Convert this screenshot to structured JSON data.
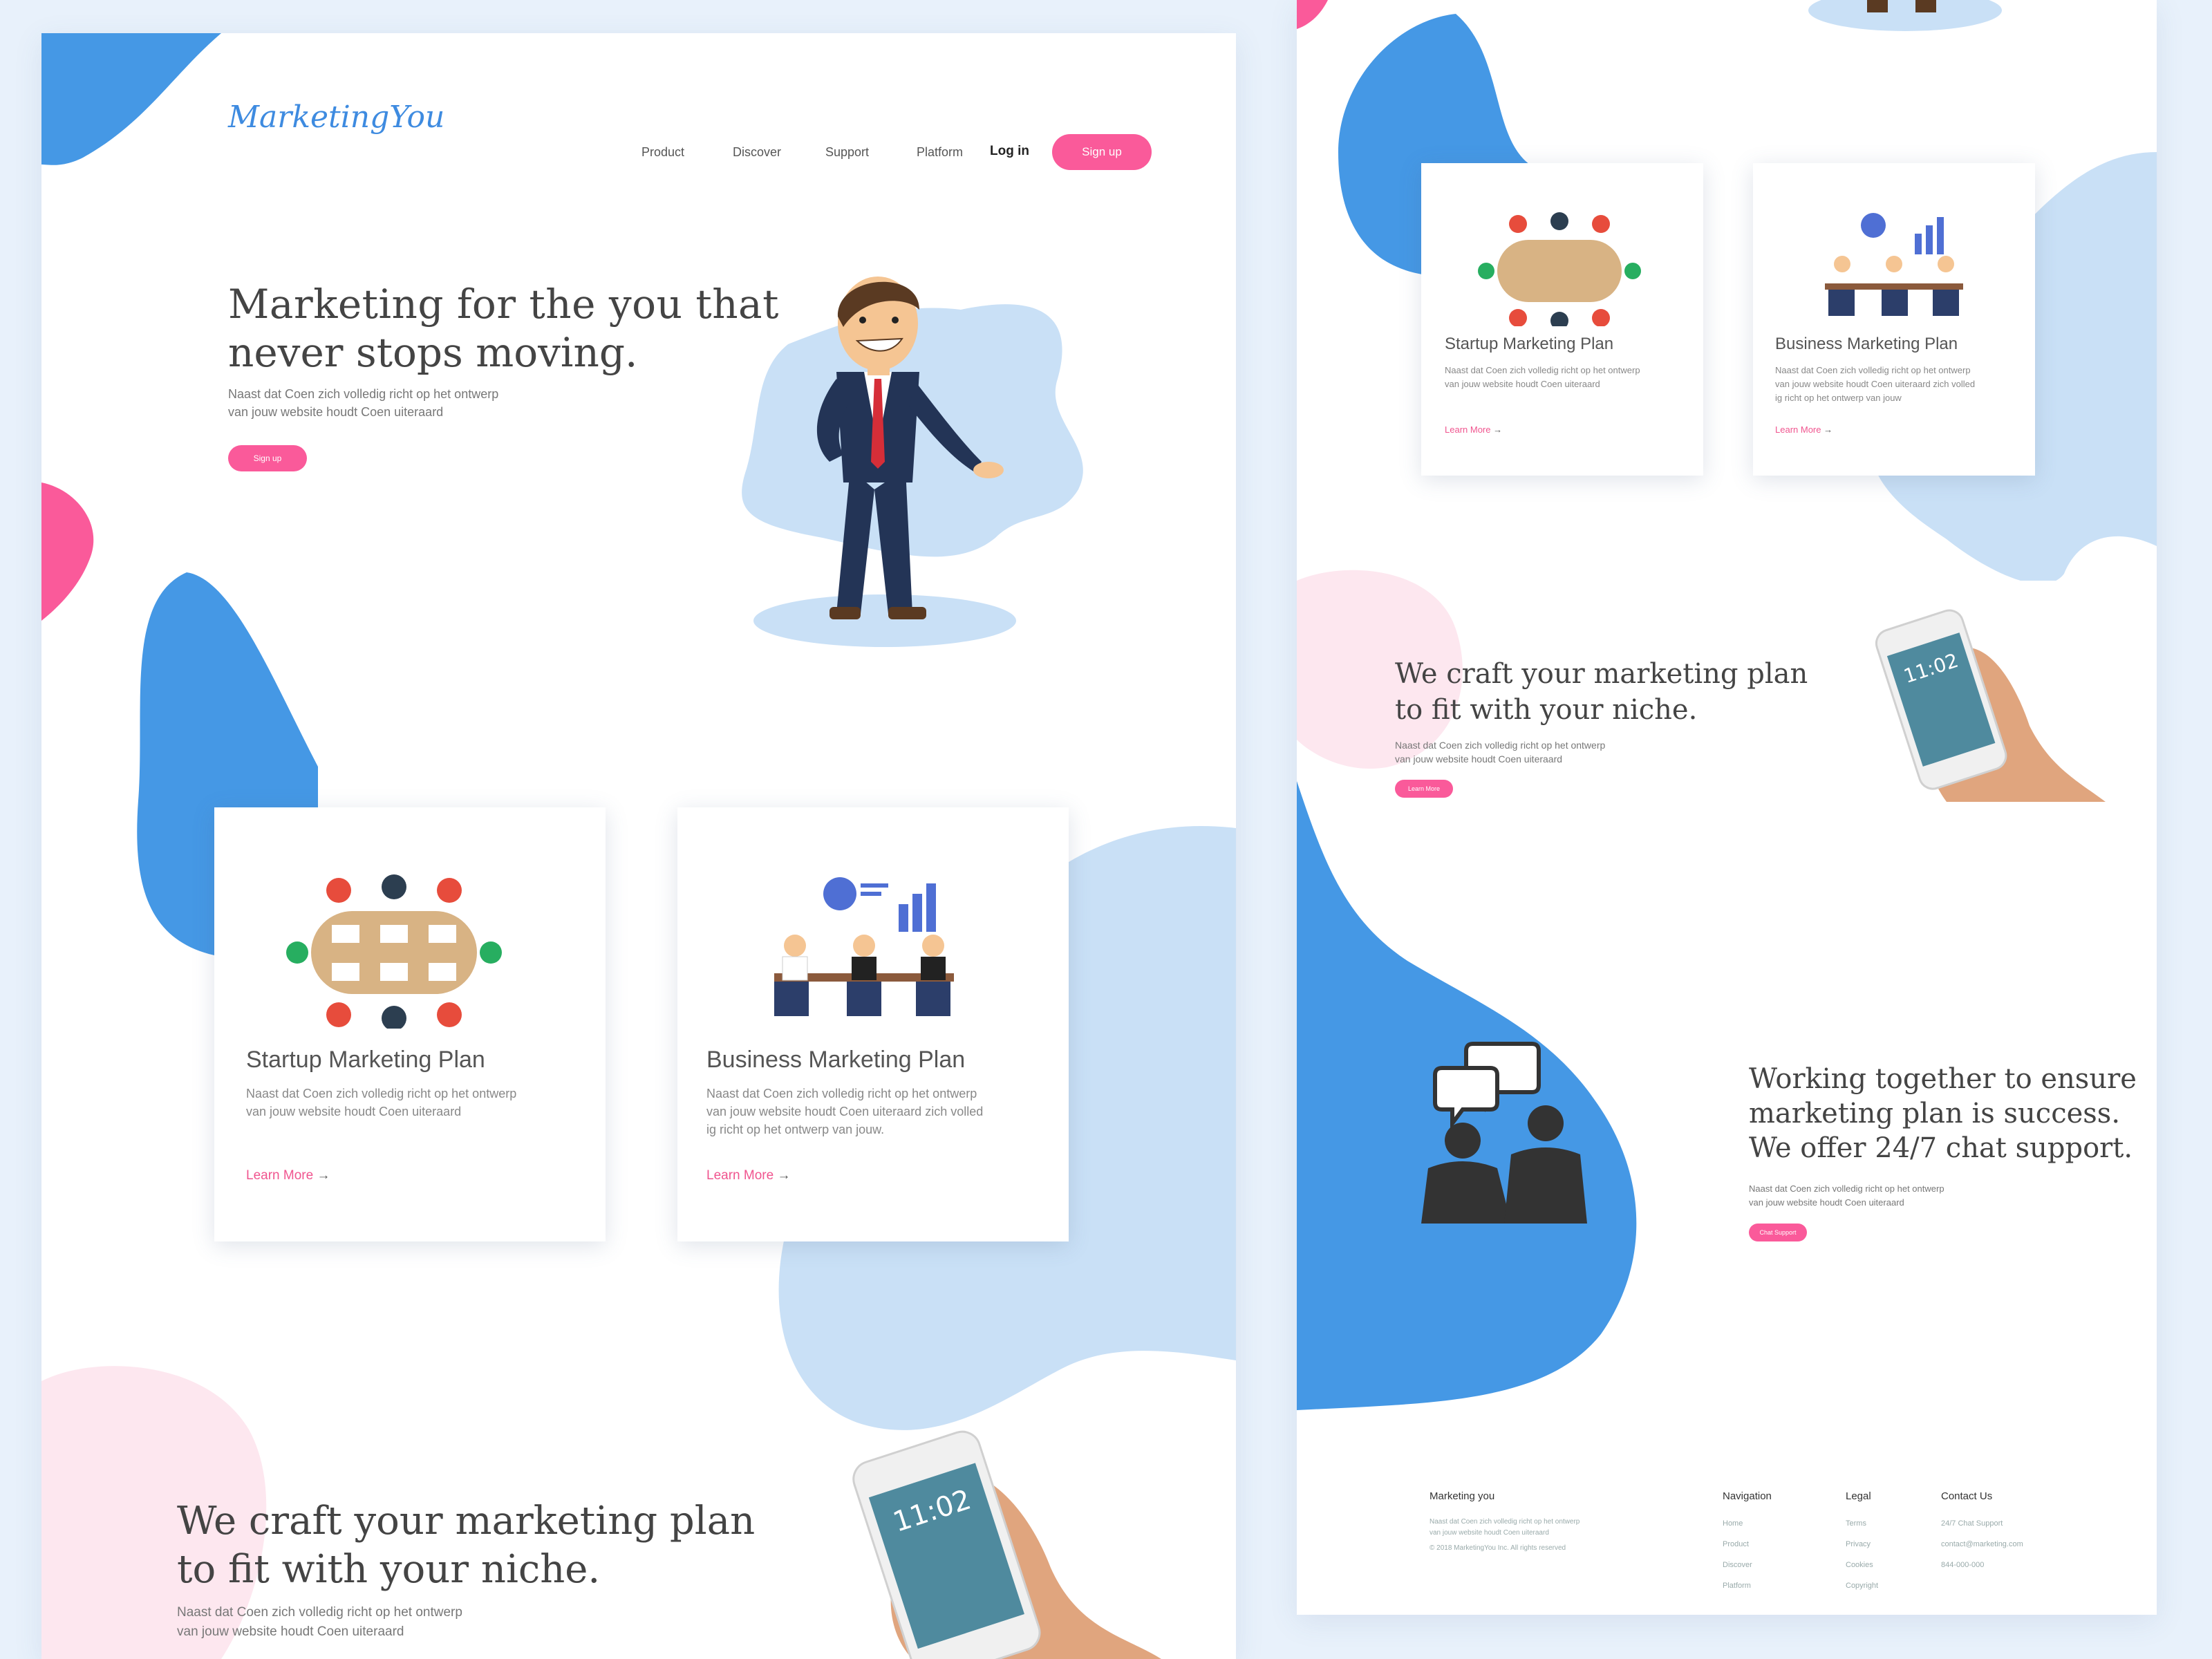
{
  "brand": {
    "logo": "MarketingYou"
  },
  "nav": {
    "links": [
      "Product",
      "Discover",
      "Support",
      "Platform"
    ],
    "login": "Log in",
    "signup": "Sign up"
  },
  "hero": {
    "title_line1": "Marketing for the you that",
    "title_line2": "never stops moving.",
    "desc_line1": "Naast dat Coen zich volledig richt op het ontwerp",
    "desc_line2": "van jouw website houdt Coen uiteraard",
    "cta": "Sign up"
  },
  "cards": [
    {
      "title": "Startup Marketing Plan",
      "desc_lines": [
        "Naast dat Coen zich volledig richt op het ontwerp",
        "van jouw website houdt Coen uiteraard"
      ],
      "link": "Learn More"
    },
    {
      "title": "Business Marketing Plan",
      "desc_lines": [
        "Naast dat Coen zich volledig richt op het ontwerp",
        "van jouw website houdt Coen uiteraard zich volled",
        "ig richt op het ontwerp van jouw."
      ],
      "link": "Learn More"
    }
  ],
  "right_cards": [
    {
      "title": "Startup Marketing Plan",
      "desc_lines": [
        "Naast dat Coen zich volledig richt op het ontwerp",
        "van jouw website houdt Coen uiteraard"
      ],
      "link": "Learn More"
    },
    {
      "title": "Business Marketing Plan",
      "desc_lines": [
        "Naast dat Coen zich volledig richt op het ontwerp",
        "van jouw website houdt Coen uiteraard zich volled",
        "ig richt op het ontwerp van jouw"
      ],
      "link": "Learn More"
    }
  ],
  "craft": {
    "title_line1": "We craft your marketing plan",
    "title_line2": "to fit with your niche.",
    "desc_line1": "Naast dat Coen zich volledig richt op het ontwerp",
    "desc_line2": "van jouw website houdt Coen uiteraard",
    "cta": "Learn More"
  },
  "phone": {
    "time": "11:02"
  },
  "support": {
    "title_line1": "Working together to ensure",
    "title_line2": "marketing plan is success.",
    "title_line3": "We offer 24/7 chat support.",
    "desc_line1": "Naast dat Coen zich volledig richt op het ontwerp",
    "desc_line2": "van jouw website houdt Coen uiteraard",
    "cta": "Chat Support"
  },
  "footer": {
    "brand_title": "Marketing you",
    "brand_desc_line1": "Naast dat Coen zich volledig richt op het ontwerp",
    "brand_desc_line2": "van jouw website houdt Coen uiteraard",
    "copyright": "2018 MarketingYou Inc. All rights reserved",
    "navigation_title": "Navigation",
    "navigation": [
      "Home",
      "Product",
      "Discover",
      "Platform"
    ],
    "legal_title": "Legal",
    "legal": [
      "Terms",
      "Privacy",
      "Cookies",
      "Copyright"
    ],
    "contact_title": "Contact Us",
    "contact": [
      "24/7 Chat Support",
      "contact@marketing.com",
      "844-000-000"
    ]
  },
  "colors": {
    "blue": "#4598e5",
    "light_blue": "#c9e0f6",
    "pink": "#fa5a9a",
    "light_pink": "#fde7ef"
  }
}
